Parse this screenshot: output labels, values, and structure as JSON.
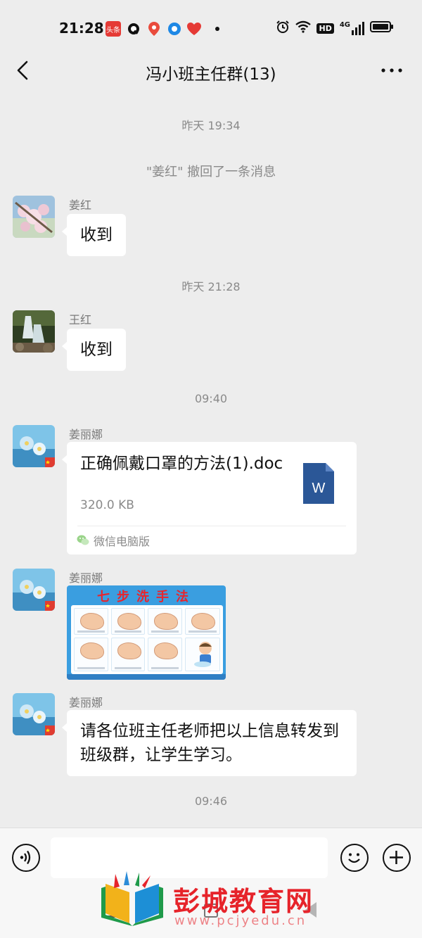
{
  "status_bar": {
    "time": "21:28",
    "notifications": [
      {
        "icon": "toutiao-app-icon",
        "label": "头条",
        "color": "#e53a35"
      },
      {
        "icon": "q-app-icon",
        "color": "#111111"
      },
      {
        "icon": "location-pin-app-icon",
        "color": "#e94b3c"
      },
      {
        "icon": "circle-app-icon",
        "color": "#1e88e5"
      },
      {
        "icon": "heart-app-icon",
        "color": "#e53a35"
      },
      {
        "icon": "more-notifications-dot-icon",
        "color": "#111111"
      }
    ],
    "hd_label": "HD",
    "signal_label": "4G"
  },
  "header": {
    "title": "冯小班主任群(13)"
  },
  "chat": {
    "timestamps": {
      "first": "昨天 19:34",
      "second": "昨天 21:28",
      "third": "09:40",
      "fourth": "09:46"
    },
    "recall_notice": "\"姜红\" 撤回了一条消息",
    "messages": [
      {
        "sender": "姜红",
        "text": "收到",
        "avatar": "cherry-blossom-avatar"
      },
      {
        "sender": "王红",
        "text": "收到",
        "avatar": "waterfall-avatar"
      },
      {
        "sender": "姜丽娜",
        "avatar": "blue-flowers-avatar",
        "file": {
          "name": "正确佩戴口罩的方法(1).doc",
          "size": "320.0 KB",
          "icon_letter": "W",
          "source": "微信电脑版"
        }
      },
      {
        "sender": "姜丽娜",
        "avatar": "blue-flowers-avatar",
        "image": {
          "title": "七步洗手法"
        }
      },
      {
        "sender": "姜丽娜",
        "avatar": "blue-flowers-avatar",
        "text": "请各位班主任老师把以上信息转发到班级群，让学生学习。"
      }
    ]
  },
  "input_bar": {
    "placeholder": ""
  },
  "watermark": {
    "name": "彭城教育网",
    "url": "www.pcjyedu.cn"
  },
  "colors": {
    "background": "#ededed",
    "bubble": "#ffffff",
    "word_blue": "#2b5797",
    "watermark_red": "#e6232a"
  }
}
